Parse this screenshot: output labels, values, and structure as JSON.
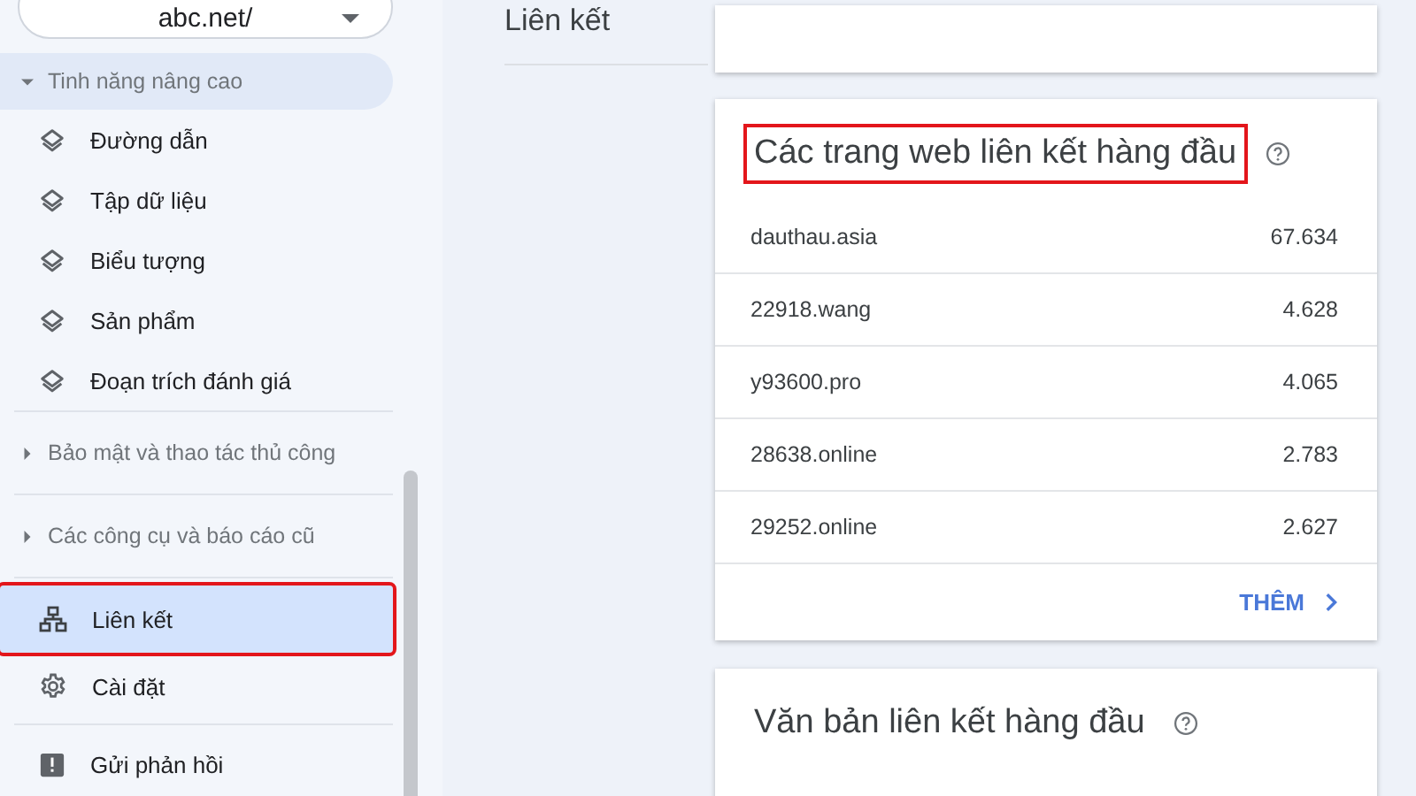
{
  "property_selector": {
    "value": "abc.net/"
  },
  "sidebar": {
    "sections": [
      {
        "entries": [
          {
            "kind": "group",
            "label": "Tinh năng nâng cao",
            "expanded": true,
            "selected": true,
            "children": [
              {
                "label": "Đường dẫn"
              },
              {
                "label": "Tập dữ liệu"
              },
              {
                "label": "Biểu tượng"
              },
              {
                "label": "Sản phẩm"
              },
              {
                "label": "Đoạn trích đánh giá"
              }
            ]
          }
        ]
      },
      {
        "entries": [
          {
            "kind": "group",
            "label": "Bảo mật và thao tác thủ công",
            "expanded": false,
            "selected": false
          }
        ]
      },
      {
        "entries": [
          {
            "kind": "group",
            "label": "Các công cụ và báo cáo cũ",
            "expanded": false,
            "selected": false
          }
        ]
      },
      {
        "entries": [
          {
            "kind": "links",
            "label": "Liên kết",
            "selected": true,
            "annotated": true
          },
          {
            "kind": "settings",
            "label": "Cài đặt",
            "selected": false,
            "annotated": false
          }
        ]
      },
      {
        "entries": [
          {
            "kind": "feedback",
            "label": "Gửi phản hồi",
            "selected": false,
            "annotated": false
          }
        ]
      }
    ]
  },
  "page_title": "Liên kết",
  "cards": [
    {
      "title": "Các trang web liên kết hàng đầu",
      "annotated": true,
      "rows": [
        {
          "site": "dauthau.asia",
          "count": "67.634"
        },
        {
          "site": "22918.wang",
          "count": "4.628"
        },
        {
          "site": "y93600.pro",
          "count": "4.065"
        },
        {
          "site": "28638.online",
          "count": "2.783"
        },
        {
          "site": "29252.online",
          "count": "2.627"
        }
      ],
      "more_link": "THÊM"
    },
    {
      "title": "Văn bản liên kết hàng đầu",
      "annotated": false
    }
  ]
}
